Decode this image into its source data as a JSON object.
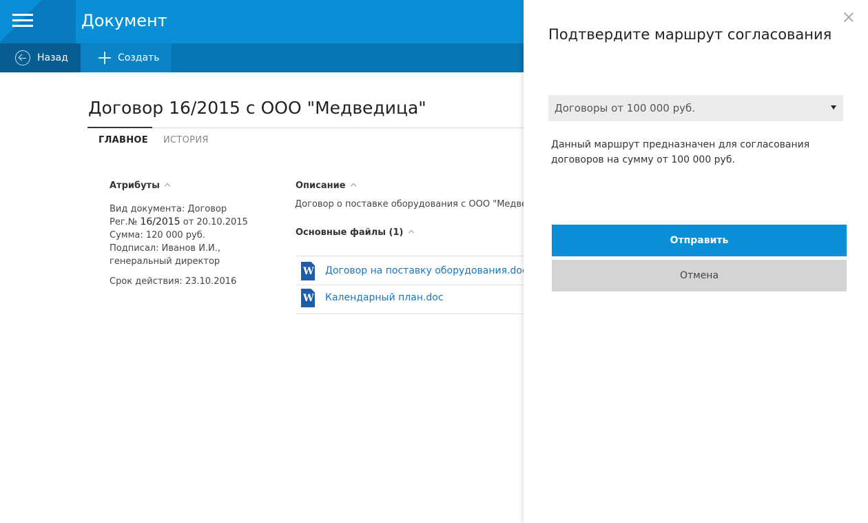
{
  "header": {
    "title": "Документ"
  },
  "toolbar": {
    "back_label": "Назад",
    "create_label": "Создать"
  },
  "document": {
    "title": "Договор 16/2015 с ООО \"Медведица\"",
    "tabs": [
      {
        "label": "ГЛАВНОЕ",
        "active": true
      },
      {
        "label": "ИСТОРИЯ",
        "active": false
      }
    ],
    "attributes": {
      "heading": "Атрибуты",
      "doc_type": "Вид документа: Договор",
      "reg_prefix": "Рег.№ ",
      "reg_number": "16/2015",
      "reg_suffix": " от 20.10.2015",
      "sum": "Сумма:  120 000 руб.",
      "signed_by": "Подписал:  Иванов И.И.,",
      "signed_position": "генеральный директор",
      "valid_until": "Срок действия: 23.10.2016"
    },
    "description": {
      "heading": "Описание",
      "text": "Договор о поставке оборудования с ООО \"Медведица\""
    },
    "files": {
      "heading": "Основные файлы (1)",
      "items": [
        {
          "name": "Договор на поставку оборудования.doc",
          "icon": "word-icon"
        },
        {
          "name": "Календарный план.doc",
          "icon": "word-icon"
        }
      ]
    }
  },
  "panel": {
    "title": "Подтвердите маршрут согласования",
    "route_select": "Договоры от 100 000 руб.",
    "route_description": "Данный маршрут предназначен для согласования договоров на сумму от 100 000 руб.",
    "send_label": "Отправить",
    "cancel_label": "Отмена"
  },
  "colors": {
    "header_bg": "#0a8ed6",
    "toolbar_bg": "#0774b3",
    "accent": "#0a8ed6",
    "link": "#1976c0"
  }
}
